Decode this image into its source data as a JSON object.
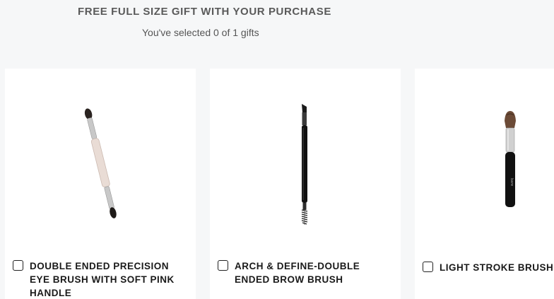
{
  "header": {
    "title": "FREE FULL SIZE GIFT WITH YOUR PURCHASE",
    "selection_status": "You've selected 0 of 1 gifts"
  },
  "gifts": [
    {
      "name": "DOUBLE ENDED PRECISION EYE BRUSH WITH SOFT PINK HANDLE",
      "selected": false,
      "image": "double-ended-pink-brush-icon"
    },
    {
      "name": "ARCH & DEFINE-DOUBLE ENDED BROW BRUSH",
      "selected": false,
      "image": "double-ended-brow-brush-icon"
    },
    {
      "name": "LIGHT STROKE BRUSH",
      "selected": false,
      "image": "light-stroke-brush-icon"
    }
  ]
}
